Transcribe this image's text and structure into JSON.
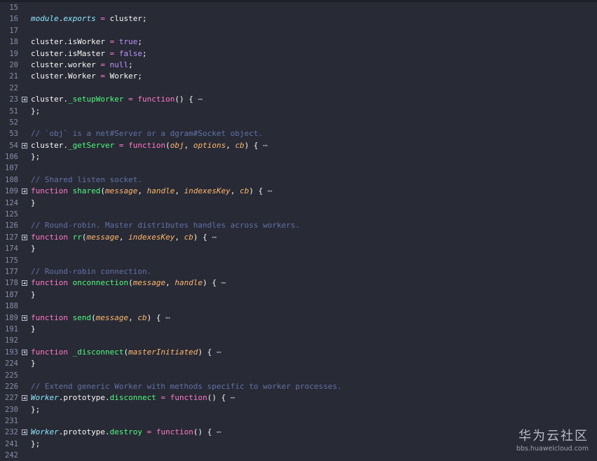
{
  "editor": {
    "lines": [
      {
        "num": "15",
        "fold": false,
        "tokens": []
      },
      {
        "num": "16",
        "fold": false,
        "tokens": [
          [
            "module",
            "type"
          ],
          [
            ".",
            "plain"
          ],
          [
            "exports",
            "type"
          ],
          [
            " ",
            "plain"
          ],
          [
            "=",
            "kw"
          ],
          [
            " cluster;",
            "plain"
          ]
        ]
      },
      {
        "num": "17",
        "fold": false,
        "tokens": []
      },
      {
        "num": "18",
        "fold": false,
        "tokens": [
          [
            "cluster.isWorker ",
            "plain"
          ],
          [
            "=",
            "kw"
          ],
          [
            " ",
            "plain"
          ],
          [
            "true",
            "bool"
          ],
          [
            ";",
            "plain"
          ]
        ]
      },
      {
        "num": "19",
        "fold": false,
        "tokens": [
          [
            "cluster.isMaster ",
            "plain"
          ],
          [
            "=",
            "kw"
          ],
          [
            " ",
            "plain"
          ],
          [
            "false",
            "bool"
          ],
          [
            ";",
            "plain"
          ]
        ]
      },
      {
        "num": "20",
        "fold": false,
        "tokens": [
          [
            "cluster.worker ",
            "plain"
          ],
          [
            "=",
            "kw"
          ],
          [
            " ",
            "plain"
          ],
          [
            "null",
            "bool"
          ],
          [
            ";",
            "plain"
          ]
        ]
      },
      {
        "num": "21",
        "fold": false,
        "tokens": [
          [
            "cluster.Worker ",
            "plain"
          ],
          [
            "=",
            "kw"
          ],
          [
            " Worker;",
            "plain"
          ]
        ]
      },
      {
        "num": "22",
        "fold": false,
        "tokens": []
      },
      {
        "num": "23",
        "fold": true,
        "tokens": [
          [
            "cluster.",
            "plain"
          ],
          [
            "_setupWorker",
            "fn"
          ],
          [
            " ",
            "plain"
          ],
          [
            "=",
            "kw"
          ],
          [
            " ",
            "plain"
          ],
          [
            "function",
            "kw"
          ],
          [
            "() { ",
            "plain"
          ],
          [
            "⋯",
            "ell"
          ]
        ]
      },
      {
        "num": "51",
        "fold": false,
        "tokens": [
          [
            "};",
            "plain"
          ]
        ]
      },
      {
        "num": "52",
        "fold": false,
        "tokens": []
      },
      {
        "num": "53",
        "fold": false,
        "tokens": [
          [
            "// `obj` is a net#Server or a dgram#Socket object.",
            "comment"
          ]
        ]
      },
      {
        "num": "54",
        "fold": true,
        "tokens": [
          [
            "cluster.",
            "plain"
          ],
          [
            "_getServer",
            "fn"
          ],
          [
            " ",
            "plain"
          ],
          [
            "=",
            "kw"
          ],
          [
            " ",
            "plain"
          ],
          [
            "function",
            "kw"
          ],
          [
            "(",
            "plain"
          ],
          [
            "obj",
            "param"
          ],
          [
            ", ",
            "plain"
          ],
          [
            "options",
            "param"
          ],
          [
            ", ",
            "plain"
          ],
          [
            "cb",
            "param"
          ],
          [
            ") { ",
            "plain"
          ],
          [
            "⋯",
            "ell"
          ]
        ]
      },
      {
        "num": "106",
        "fold": false,
        "tokens": [
          [
            "};",
            "plain"
          ]
        ]
      },
      {
        "num": "107",
        "fold": false,
        "tokens": []
      },
      {
        "num": "108",
        "fold": false,
        "tokens": [
          [
            "// Shared listen socket.",
            "comment"
          ]
        ]
      },
      {
        "num": "109",
        "fold": true,
        "tokens": [
          [
            "function",
            "kw"
          ],
          [
            " ",
            "plain"
          ],
          [
            "shared",
            "fn"
          ],
          [
            "(",
            "plain"
          ],
          [
            "message",
            "param"
          ],
          [
            ", ",
            "plain"
          ],
          [
            "handle",
            "param"
          ],
          [
            ", ",
            "plain"
          ],
          [
            "indexesKey",
            "param"
          ],
          [
            ", ",
            "plain"
          ],
          [
            "cb",
            "param"
          ],
          [
            ") { ",
            "plain"
          ],
          [
            "⋯",
            "ell"
          ]
        ]
      },
      {
        "num": "124",
        "fold": false,
        "tokens": [
          [
            "}",
            "plain"
          ]
        ]
      },
      {
        "num": "125",
        "fold": false,
        "tokens": []
      },
      {
        "num": "126",
        "fold": false,
        "tokens": [
          [
            "// Round-robin. Master distributes handles across workers.",
            "comment"
          ]
        ]
      },
      {
        "num": "127",
        "fold": true,
        "tokens": [
          [
            "function",
            "kw"
          ],
          [
            " ",
            "plain"
          ],
          [
            "rr",
            "fn"
          ],
          [
            "(",
            "plain"
          ],
          [
            "message",
            "param"
          ],
          [
            ", ",
            "plain"
          ],
          [
            "indexesKey",
            "param"
          ],
          [
            ", ",
            "plain"
          ],
          [
            "cb",
            "param"
          ],
          [
            ") { ",
            "plain"
          ],
          [
            "⋯",
            "ell"
          ]
        ]
      },
      {
        "num": "174",
        "fold": false,
        "tokens": [
          [
            "}",
            "plain"
          ]
        ]
      },
      {
        "num": "175",
        "fold": false,
        "tokens": []
      },
      {
        "num": "177",
        "fold": false,
        "tokens": [
          [
            "// Round-robin connection.",
            "comment"
          ]
        ]
      },
      {
        "num": "178",
        "fold": true,
        "tokens": [
          [
            "function",
            "kw"
          ],
          [
            " ",
            "plain"
          ],
          [
            "onconnection",
            "fn"
          ],
          [
            "(",
            "plain"
          ],
          [
            "message",
            "param"
          ],
          [
            ", ",
            "plain"
          ],
          [
            "handle",
            "param"
          ],
          [
            ") { ",
            "plain"
          ],
          [
            "⋯",
            "ell"
          ]
        ]
      },
      {
        "num": "187",
        "fold": false,
        "tokens": [
          [
            "}",
            "plain"
          ]
        ]
      },
      {
        "num": "188",
        "fold": false,
        "tokens": []
      },
      {
        "num": "189",
        "fold": true,
        "tokens": [
          [
            "function",
            "kw"
          ],
          [
            " ",
            "plain"
          ],
          [
            "send",
            "fn"
          ],
          [
            "(",
            "plain"
          ],
          [
            "message",
            "param"
          ],
          [
            ", ",
            "plain"
          ],
          [
            "cb",
            "param"
          ],
          [
            ") { ",
            "plain"
          ],
          [
            "⋯",
            "ell"
          ]
        ]
      },
      {
        "num": "191",
        "fold": false,
        "tokens": [
          [
            "}",
            "plain"
          ]
        ]
      },
      {
        "num": "192",
        "fold": false,
        "tokens": []
      },
      {
        "num": "193",
        "fold": true,
        "tokens": [
          [
            "function",
            "kw"
          ],
          [
            " ",
            "plain"
          ],
          [
            "_disconnect",
            "fn"
          ],
          [
            "(",
            "plain"
          ],
          [
            "masterInitiated",
            "param"
          ],
          [
            ") { ",
            "plain"
          ],
          [
            "⋯",
            "ell"
          ]
        ]
      },
      {
        "num": "224",
        "fold": false,
        "tokens": [
          [
            "}",
            "plain"
          ]
        ]
      },
      {
        "num": "225",
        "fold": false,
        "tokens": []
      },
      {
        "num": "226",
        "fold": false,
        "tokens": [
          [
            "// Extend generic Worker with methods specific to worker processes.",
            "comment"
          ]
        ]
      },
      {
        "num": "227",
        "fold": true,
        "tokens": [
          [
            "Worker",
            "type"
          ],
          [
            ".prototype.",
            "plain"
          ],
          [
            "disconnect",
            "fn"
          ],
          [
            " ",
            "plain"
          ],
          [
            "=",
            "kw"
          ],
          [
            " ",
            "plain"
          ],
          [
            "function",
            "kw"
          ],
          [
            "() { ",
            "plain"
          ],
          [
            "⋯",
            "ell"
          ]
        ]
      },
      {
        "num": "230",
        "fold": false,
        "tokens": [
          [
            "};",
            "plain"
          ]
        ]
      },
      {
        "num": "231",
        "fold": false,
        "tokens": []
      },
      {
        "num": "232",
        "fold": true,
        "tokens": [
          [
            "Worker",
            "type"
          ],
          [
            ".prototype.",
            "plain"
          ],
          [
            "destroy",
            "fn"
          ],
          [
            " ",
            "plain"
          ],
          [
            "=",
            "kw"
          ],
          [
            " ",
            "plain"
          ],
          [
            "function",
            "kw"
          ],
          [
            "() { ",
            "plain"
          ],
          [
            "⋯",
            "ell"
          ]
        ]
      },
      {
        "num": "241",
        "fold": false,
        "tokens": [
          [
            "};",
            "plain"
          ]
        ]
      },
      {
        "num": "242",
        "fold": false,
        "tokens": []
      }
    ]
  },
  "watermark": {
    "brand": "华为云社区",
    "url": "bbs.huaweicloud.com"
  },
  "colors": {
    "background": "#282a36",
    "keyword": "#ff79c6",
    "function_name": "#50fa7b",
    "parameter": "#ffb86c",
    "constant": "#bd93f9",
    "comment": "#6272a4",
    "type": "#8be9fd"
  },
  "icons": {
    "fold": "fold-expand-icon",
    "ellipsis": "folded-code-ellipsis-icon"
  }
}
